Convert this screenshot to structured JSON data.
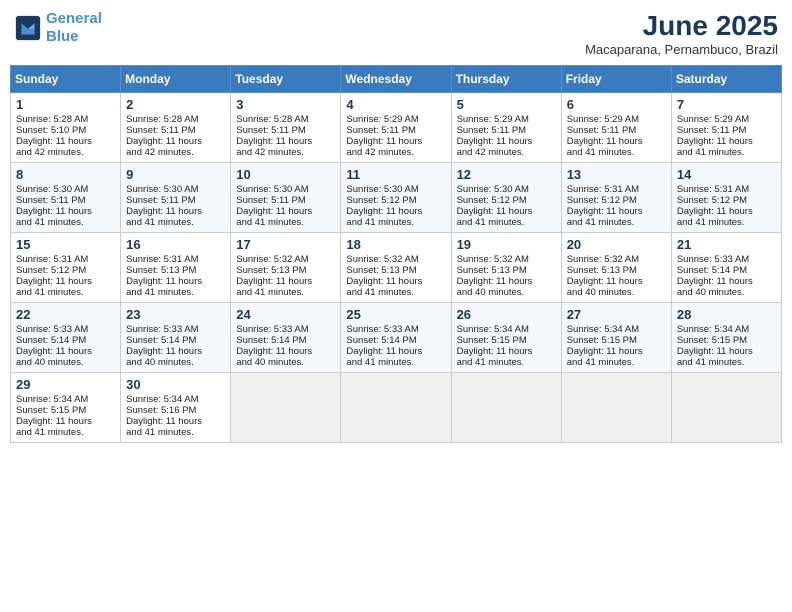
{
  "header": {
    "logo_line1": "General",
    "logo_line2": "Blue",
    "month_year": "June 2025",
    "location": "Macaparana, Pernambuco, Brazil"
  },
  "days_of_week": [
    "Sunday",
    "Monday",
    "Tuesday",
    "Wednesday",
    "Thursday",
    "Friday",
    "Saturday"
  ],
  "weeks": [
    [
      {
        "day": 1,
        "rise": "5:28 AM",
        "set": "5:10 PM",
        "dl": "11 hours and 42 minutes."
      },
      {
        "day": 2,
        "rise": "5:28 AM",
        "set": "5:11 PM",
        "dl": "11 hours and 42 minutes."
      },
      {
        "day": 3,
        "rise": "5:28 AM",
        "set": "5:11 PM",
        "dl": "11 hours and 42 minutes."
      },
      {
        "day": 4,
        "rise": "5:29 AM",
        "set": "5:11 PM",
        "dl": "11 hours and 42 minutes."
      },
      {
        "day": 5,
        "rise": "5:29 AM",
        "set": "5:11 PM",
        "dl": "11 hours and 42 minutes."
      },
      {
        "day": 6,
        "rise": "5:29 AM",
        "set": "5:11 PM",
        "dl": "11 hours and 41 minutes."
      },
      {
        "day": 7,
        "rise": "5:29 AM",
        "set": "5:11 PM",
        "dl": "11 hours and 41 minutes."
      }
    ],
    [
      {
        "day": 8,
        "rise": "5:30 AM",
        "set": "5:11 PM",
        "dl": "11 hours and 41 minutes."
      },
      {
        "day": 9,
        "rise": "5:30 AM",
        "set": "5:11 PM",
        "dl": "11 hours and 41 minutes."
      },
      {
        "day": 10,
        "rise": "5:30 AM",
        "set": "5:11 PM",
        "dl": "11 hours and 41 minutes."
      },
      {
        "day": 11,
        "rise": "5:30 AM",
        "set": "5:12 PM",
        "dl": "11 hours and 41 minutes."
      },
      {
        "day": 12,
        "rise": "5:30 AM",
        "set": "5:12 PM",
        "dl": "11 hours and 41 minutes."
      },
      {
        "day": 13,
        "rise": "5:31 AM",
        "set": "5:12 PM",
        "dl": "11 hours and 41 minutes."
      },
      {
        "day": 14,
        "rise": "5:31 AM",
        "set": "5:12 PM",
        "dl": "11 hours and 41 minutes."
      }
    ],
    [
      {
        "day": 15,
        "rise": "5:31 AM",
        "set": "5:12 PM",
        "dl": "11 hours and 41 minutes."
      },
      {
        "day": 16,
        "rise": "5:31 AM",
        "set": "5:13 PM",
        "dl": "11 hours and 41 minutes."
      },
      {
        "day": 17,
        "rise": "5:32 AM",
        "set": "5:13 PM",
        "dl": "11 hours and 41 minutes."
      },
      {
        "day": 18,
        "rise": "5:32 AM",
        "set": "5:13 PM",
        "dl": "11 hours and 41 minutes."
      },
      {
        "day": 19,
        "rise": "5:32 AM",
        "set": "5:13 PM",
        "dl": "11 hours and 40 minutes."
      },
      {
        "day": 20,
        "rise": "5:32 AM",
        "set": "5:13 PM",
        "dl": "11 hours and 40 minutes."
      },
      {
        "day": 21,
        "rise": "5:33 AM",
        "set": "5:14 PM",
        "dl": "11 hours and 40 minutes."
      }
    ],
    [
      {
        "day": 22,
        "rise": "5:33 AM",
        "set": "5:14 PM",
        "dl": "11 hours and 40 minutes."
      },
      {
        "day": 23,
        "rise": "5:33 AM",
        "set": "5:14 PM",
        "dl": "11 hours and 40 minutes."
      },
      {
        "day": 24,
        "rise": "5:33 AM",
        "set": "5:14 PM",
        "dl": "11 hours and 40 minutes."
      },
      {
        "day": 25,
        "rise": "5:33 AM",
        "set": "5:14 PM",
        "dl": "11 hours and 41 minutes."
      },
      {
        "day": 26,
        "rise": "5:34 AM",
        "set": "5:15 PM",
        "dl": "11 hours and 41 minutes."
      },
      {
        "day": 27,
        "rise": "5:34 AM",
        "set": "5:15 PM",
        "dl": "11 hours and 41 minutes."
      },
      {
        "day": 28,
        "rise": "5:34 AM",
        "set": "5:15 PM",
        "dl": "11 hours and 41 minutes."
      }
    ],
    [
      {
        "day": 29,
        "rise": "5:34 AM",
        "set": "5:15 PM",
        "dl": "11 hours and 41 minutes."
      },
      {
        "day": 30,
        "rise": "5:34 AM",
        "set": "5:16 PM",
        "dl": "11 hours and 41 minutes."
      },
      null,
      null,
      null,
      null,
      null
    ]
  ]
}
